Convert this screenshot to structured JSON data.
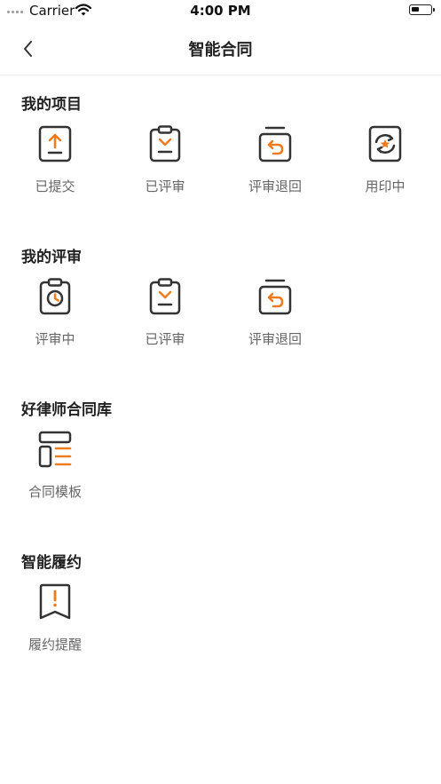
{
  "status_bar": {
    "carrier": "Carrier",
    "time": "4:00 PM",
    "battery_level": 0.25
  },
  "nav": {
    "title": "智能合同"
  },
  "colors": {
    "accent": "#F07A1E",
    "icon_stroke": "#333333",
    "label": "#666666"
  },
  "sections": [
    {
      "title": "我的项目",
      "items": [
        {
          "label": "已提交",
          "icon": "upload-doc-icon"
        },
        {
          "label": "已评审",
          "icon": "clipboard-check-icon"
        },
        {
          "label": "评审退回",
          "icon": "returned-tray-icon"
        },
        {
          "label": "用印中",
          "icon": "stamp-refresh-icon"
        }
      ]
    },
    {
      "title": "我的评审",
      "items": [
        {
          "label": "评审中",
          "icon": "clipboard-clock-icon"
        },
        {
          "label": "已评审",
          "icon": "clipboard-check-icon"
        },
        {
          "label": "评审退回",
          "icon": "returned-tray-icon"
        }
      ]
    },
    {
      "title": "好律师合同库",
      "items": [
        {
          "label": "合同模板",
          "icon": "template-layout-icon"
        }
      ]
    },
    {
      "title": "智能履约",
      "items": [
        {
          "label": "履约提醒",
          "icon": "alert-bookmark-icon"
        }
      ]
    }
  ]
}
